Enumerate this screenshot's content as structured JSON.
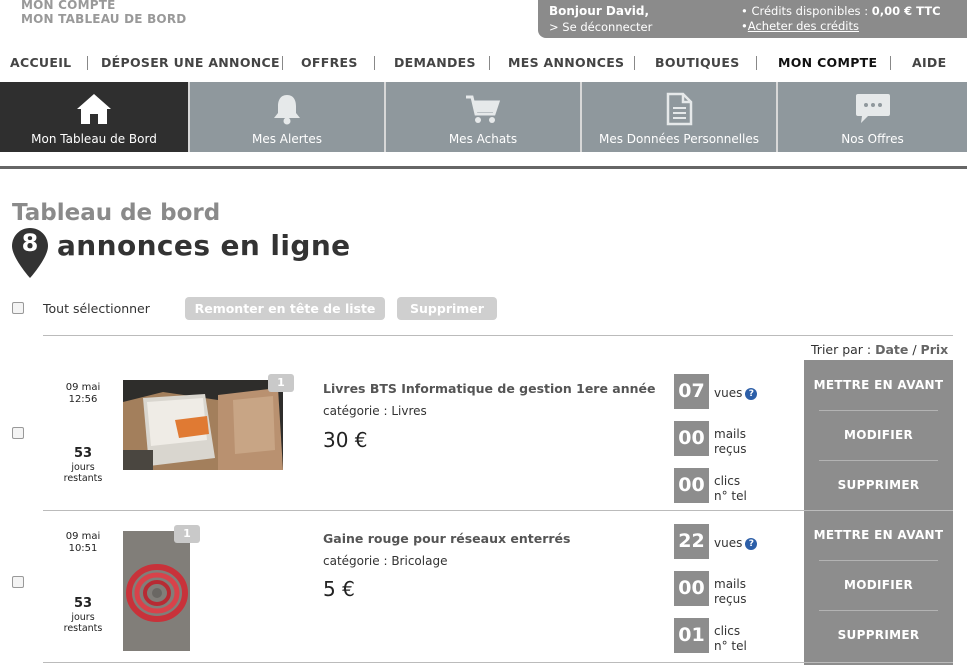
{
  "breadcrumb": {
    "line1": "MON COMPTE",
    "line2": "MON TABLEAU DE BORD"
  },
  "user": {
    "greeting": "Bonjour David,",
    "logout": "> Se déconnecter",
    "credits_label": "• Crédits disponibles : ",
    "credits_value": "0,00 € TTC",
    "buy_prefix": "• ",
    "buy_link": "Acheter des crédits"
  },
  "nav": [
    "ACCUEIL",
    "DÉPOSER UNE ANNONCE",
    "OFFRES",
    "DEMANDES",
    "MES ANNONCES",
    "BOUTIQUES",
    "MON COMPTE",
    "AIDE"
  ],
  "tabs": [
    {
      "label": "Mon Tableau de Bord",
      "icon": "home-icon",
      "active": true
    },
    {
      "label": "Mes Alertes",
      "icon": "bell-icon"
    },
    {
      "label": "Mes Achats",
      "icon": "cart-icon"
    },
    {
      "label": "Mes Données Personnelles",
      "icon": "document-icon"
    },
    {
      "label": "Nos Offres",
      "icon": "chat-bubble-icon"
    }
  ],
  "page": {
    "title": "Tableau de bord",
    "count": "8",
    "subtitle": "annonces en ligne"
  },
  "controls": {
    "select_all": "Tout sélectionner",
    "bump": "Remonter en tête de liste",
    "delete": "Supprimer"
  },
  "sort": {
    "label": "Trier par : ",
    "date": "Date",
    "sep": " / ",
    "price": "Prix"
  },
  "listings": [
    {
      "date": "09 mai",
      "time": "12:56",
      "days": "53",
      "days_l1": "jours",
      "days_l2": "restants",
      "photos": "1",
      "title": "Livres BTS Informatique de gestion 1ere année",
      "category": "catégorie : Livres",
      "price": "30 €",
      "views": "07",
      "views_label": "vues",
      "mails": "00",
      "mails_l1": "mails",
      "mails_l2": "reçus",
      "clicks": "00",
      "clicks_l1": "clics",
      "clicks_l2": "n° tel"
    },
    {
      "date": "09 mai",
      "time": "10:51",
      "days": "53",
      "days_l1": "jours",
      "days_l2": "restants",
      "photos": "1",
      "title": "Gaine rouge pour réseaux enterrés",
      "category": "catégorie : Bricolage",
      "price": "5 €",
      "views": "22",
      "views_label": "vues",
      "mails": "00",
      "mails_l1": "mails",
      "mails_l2": "reçus",
      "clicks": "01",
      "clicks_l1": "clics",
      "clicks_l2": "n° tel"
    }
  ],
  "actions": {
    "feature": "METTRE EN AVANT",
    "edit": "MODIFIER",
    "delete": "SUPPRIMER"
  },
  "colors": {
    "tab_bar": "#8f989d",
    "tab_active": "#2f2f2f",
    "stat_box": "#8d8d8d",
    "help_icon": "#2d5fa8"
  }
}
